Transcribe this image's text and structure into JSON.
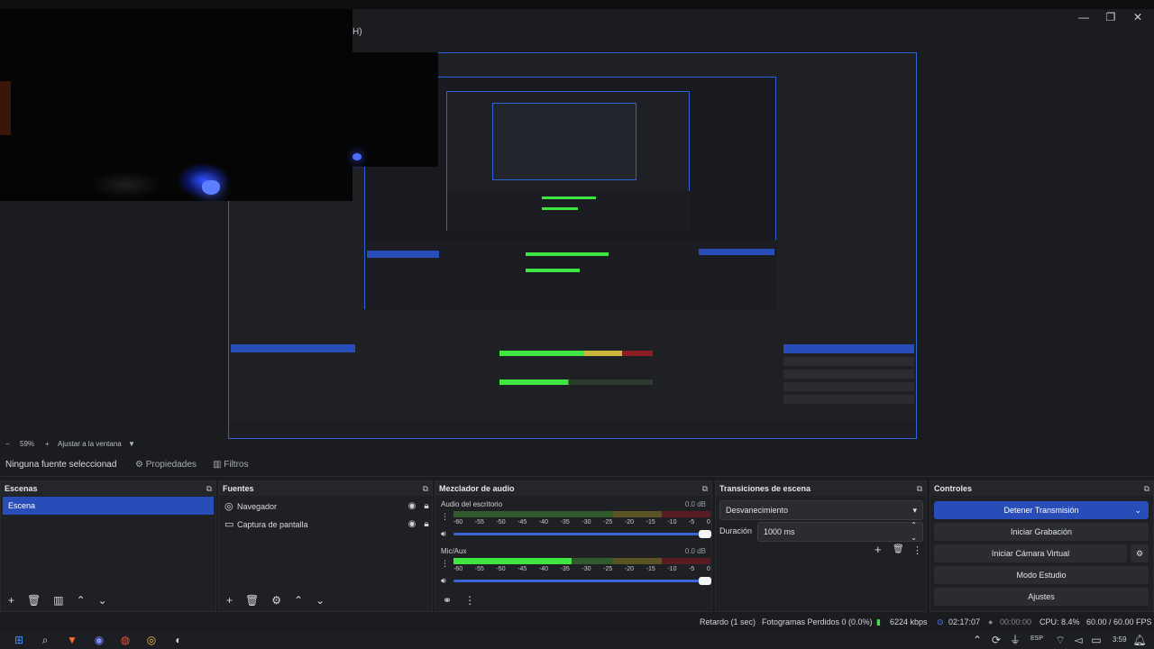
{
  "window": {
    "title_suffix": "H)",
    "controls": {
      "minimize": "—",
      "maximize": "❐",
      "close": "✕"
    }
  },
  "zoom": {
    "minus": "−",
    "value": "59%",
    "plus": "+",
    "fit_label": "Ajustar a la ventana",
    "dropdown": "▼"
  },
  "context_bar": {
    "no_source": "Ninguna fuente seleccionad",
    "properties": "Propiedades",
    "filters": "Filtros"
  },
  "docks": {
    "scenes": {
      "title": "Escenas",
      "items": [
        "Escena"
      ]
    },
    "sources": {
      "title": "Fuentes",
      "items": [
        {
          "label": "Navegador",
          "icon": "globe-icon"
        },
        {
          "label": "Captura de pantalla",
          "icon": "monitor-icon"
        }
      ]
    },
    "mixer": {
      "title": "Mezclador de audio",
      "channels": [
        {
          "name": "Audio del escritorio",
          "db": "0.0 dB",
          "level": 0.0
        },
        {
          "name": "Mic/Aux",
          "db": "0.0 dB",
          "level": 0.46
        }
      ],
      "scale": [
        "-60",
        "-55",
        "-50",
        "-45",
        "-40",
        "-35",
        "-30",
        "-25",
        "-20",
        "-15",
        "-10",
        "-5",
        "0"
      ]
    },
    "transitions": {
      "title": "Transiciones de escena",
      "selected": "Desvanecimiento",
      "duration_label": "Duración",
      "duration_value": "1000 ms"
    },
    "controls": {
      "title": "Controles",
      "stop_stream": "Detener Transmisión",
      "start_record": "Iniciar Grabación",
      "start_virtual_cam": "Iniciar Cámara Virtual",
      "studio_mode": "Modo Estudio",
      "settings": "Ajustes"
    }
  },
  "status": {
    "delay": "Retardo (1 sec)",
    "dropped": "Fotogramas Perdidos 0 (0.0%)",
    "bitrate": "6224 kbps",
    "stream_time": "02:17:07",
    "rec_time": "00:00:00",
    "cpu": "CPU: 8.4%",
    "fps": "60.00 / 60.00 FPS"
  },
  "taskbar": {
    "lang": "ESP",
    "time": "3:59"
  },
  "colors": {
    "accent": "#284cb8",
    "preview_border": "#2c64d6",
    "meter_green": "#3de641",
    "meter_yellow": "#c8b73a",
    "meter_red": "#8a1f28"
  }
}
